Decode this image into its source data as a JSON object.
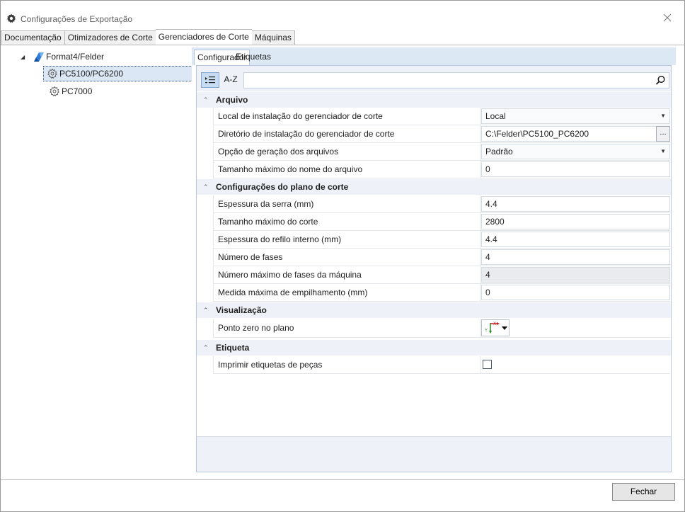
{
  "window": {
    "title": "Configurações de Exportação"
  },
  "main_tabs": [
    {
      "label": "Documentação",
      "active": false
    },
    {
      "label": "Otimizadores de Corte",
      "active": false
    },
    {
      "label": "Gerenciadores de Corte",
      "active": true
    },
    {
      "label": "Máquinas",
      "active": false
    }
  ],
  "tree": {
    "root": "Format4/Felder",
    "children": [
      {
        "label": "PC5100/PC6200",
        "selected": true
      },
      {
        "label": "PC7000",
        "selected": false
      }
    ]
  },
  "sub_tabs": [
    {
      "label": "Configurador",
      "active": true
    },
    {
      "label": "Etiquetas",
      "active": false
    }
  ],
  "toolbar": {
    "categorized_icon": "categorized-icon",
    "az_label": "A-Z",
    "search_placeholder": "",
    "search_icon": "search-icon"
  },
  "sections": {
    "arquivo": {
      "title": "Arquivo",
      "rows": {
        "local": {
          "label": "Local de instalação do gerenciador de corte",
          "value": "Local"
        },
        "diretorio": {
          "label": "Diretório de instalação do gerenciador de corte",
          "value": "C:\\Felder\\PC5100_PC6200",
          "button": "..."
        },
        "opcao": {
          "label": "Opção de geração dos arquivos",
          "value": "Padrão"
        },
        "tamanho_nome": {
          "label": "Tamanho máximo do nome do arquivo",
          "value": "0"
        }
      }
    },
    "plano": {
      "title": "Configurações do plano de corte",
      "rows": {
        "espessura_serra": {
          "label": "Espessura da serra (mm)",
          "value": "4.4"
        },
        "tamanho_corte": {
          "label": "Tamanho máximo do corte",
          "value": "2800"
        },
        "espessura_refilo": {
          "label": "Espessura do refilo interno (mm)",
          "value": "4.4"
        },
        "numero_fases": {
          "label": "Número de fases",
          "value": "4"
        },
        "numero_max_fases": {
          "label": "Número máximo de fases da máquina",
          "value": "4"
        },
        "medida_empilhamento": {
          "label": "Medida máxima de empilhamento (mm)",
          "value": "0"
        }
      }
    },
    "visualizacao": {
      "title": "Visualização",
      "rows": {
        "ponto_zero": {
          "label": "Ponto zero no plano",
          "icon": "axis-origin-icon"
        }
      }
    },
    "etiqueta": {
      "title": "Etiqueta",
      "rows": {
        "imprimir": {
          "label": "Imprimir etiquetas de peças",
          "checked": false
        }
      }
    }
  },
  "footer": {
    "close_label": "Fechar"
  },
  "colors": {
    "accent_light": "#dde8f5",
    "section_bg": "#eef2f8",
    "selected_tree": "#dbe7f5"
  }
}
